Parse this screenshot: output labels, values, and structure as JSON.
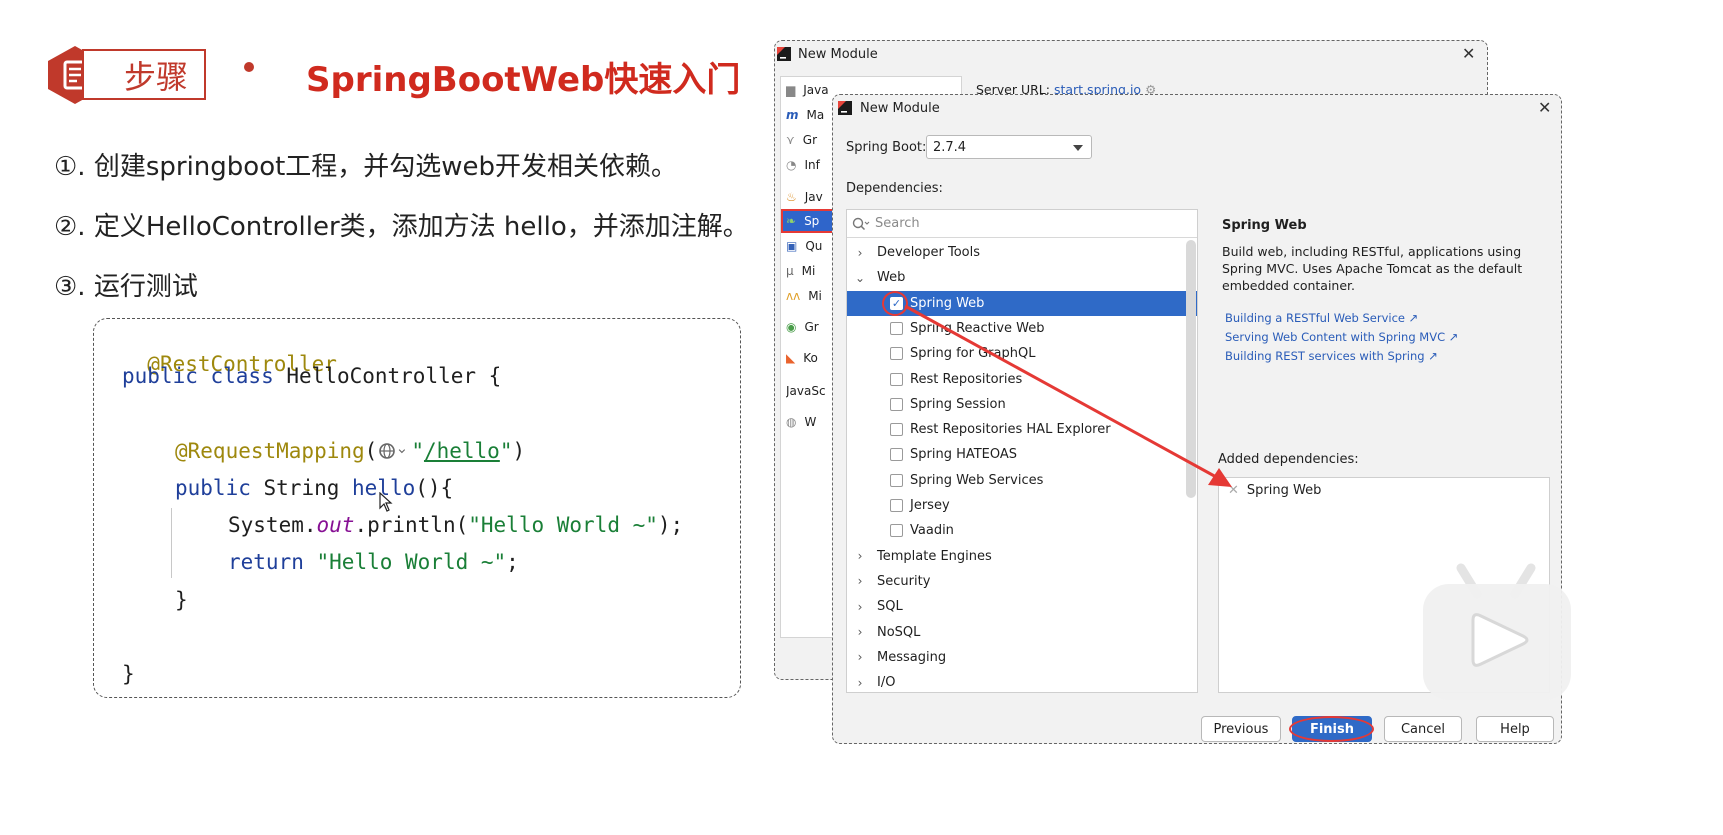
{
  "slide": {
    "badge_text": "步骤",
    "title": "SpringBootWeb快速入门",
    "steps": [
      "①. 创建springboot工程，并勾选web开发相关依赖。",
      "②. 定义HelloController类，添加方法 hello，并添加注解。",
      "③. 运行测试"
    ]
  },
  "code": {
    "line1": "@RestController",
    "line2_kw": "public class ",
    "line2_name": "HelloController {",
    "line3_ann": "@RequestMapping",
    "line3_open": "(",
    "line3_str_q1": "\"",
    "line3_url": "/hello",
    "line3_str_q2": "\"",
    "line3_close": ")",
    "line4_kw": "public ",
    "line4_type": "String ",
    "line4_method": "hello",
    "line4_rest": "(){",
    "line5_obj": "System.",
    "line5_field": "out",
    "line5_call": ".println(",
    "line5_str": "\"Hello World ~\"",
    "line5_end": ");",
    "line6_kw": "return ",
    "line6_str": "\"Hello World ~\"",
    "line6_end": ";",
    "line7": "}",
    "line8": "}"
  },
  "back_dialog": {
    "title": "New Module",
    "server_label": "Server URL:",
    "server_url": "start.spring.io",
    "items": [
      "Java",
      "Ma",
      "Gr",
      "Inf",
      "Jav",
      "Sp",
      "Qu",
      "Mi",
      "Mi",
      "Gr",
      "Ko",
      "JavaSc",
      "W"
    ]
  },
  "front_dialog": {
    "title": "New Module",
    "spring_boot_label": "Spring Boot:",
    "spring_boot_version": "2.7.4",
    "dependencies_label": "Dependencies:",
    "search_placeholder": "Search",
    "tree": [
      {
        "label": "Developer Tools",
        "kind": "group",
        "expanded": false
      },
      {
        "label": "Web",
        "kind": "group",
        "expanded": true
      },
      {
        "label": "Spring Web",
        "kind": "item",
        "checked": true
      },
      {
        "label": "Spring Reactive Web",
        "kind": "item",
        "checked": false
      },
      {
        "label": "Spring for GraphQL",
        "kind": "item",
        "checked": false
      },
      {
        "label": "Rest Repositories",
        "kind": "item",
        "checked": false
      },
      {
        "label": "Spring Session",
        "kind": "item",
        "checked": false
      },
      {
        "label": "Rest Repositories HAL Explorer",
        "kind": "item",
        "checked": false
      },
      {
        "label": "Spring HATEOAS",
        "kind": "item",
        "checked": false
      },
      {
        "label": "Spring Web Services",
        "kind": "item",
        "checked": false
      },
      {
        "label": "Jersey",
        "kind": "item",
        "checked": false
      },
      {
        "label": "Vaadin",
        "kind": "item",
        "checked": false
      },
      {
        "label": "Template Engines",
        "kind": "group",
        "expanded": false
      },
      {
        "label": "Security",
        "kind": "group",
        "expanded": false
      },
      {
        "label": "SQL",
        "kind": "group",
        "expanded": false
      },
      {
        "label": "NoSQL",
        "kind": "group",
        "expanded": false
      },
      {
        "label": "Messaging",
        "kind": "group",
        "expanded": false
      },
      {
        "label": "I/O",
        "kind": "group",
        "expanded": false
      }
    ],
    "detail_title": "Spring Web",
    "detail_desc": "Build web, including RESTful, applications using Spring MVC. Uses Apache Tomcat as the default embedded container.",
    "links": [
      "Building a RESTful Web Service ↗",
      "Serving Web Content with Spring MVC ↗",
      "Building REST services with Spring ↗"
    ],
    "added_label": "Added dependencies:",
    "added_items": [
      "Spring Web"
    ],
    "buttons": {
      "previous": "Previous",
      "finish": "Finish",
      "cancel": "Cancel",
      "help": "Help"
    }
  },
  "colors": {
    "accent_red": "#d02a1e",
    "selection_blue": "#2f6ac7",
    "link_blue": "#2a5cb8"
  },
  "icons": [
    "document-icon",
    "globe-icon",
    "settings-icon",
    "close-icon",
    "check-icon",
    "play-icon",
    "module-icon"
  ]
}
